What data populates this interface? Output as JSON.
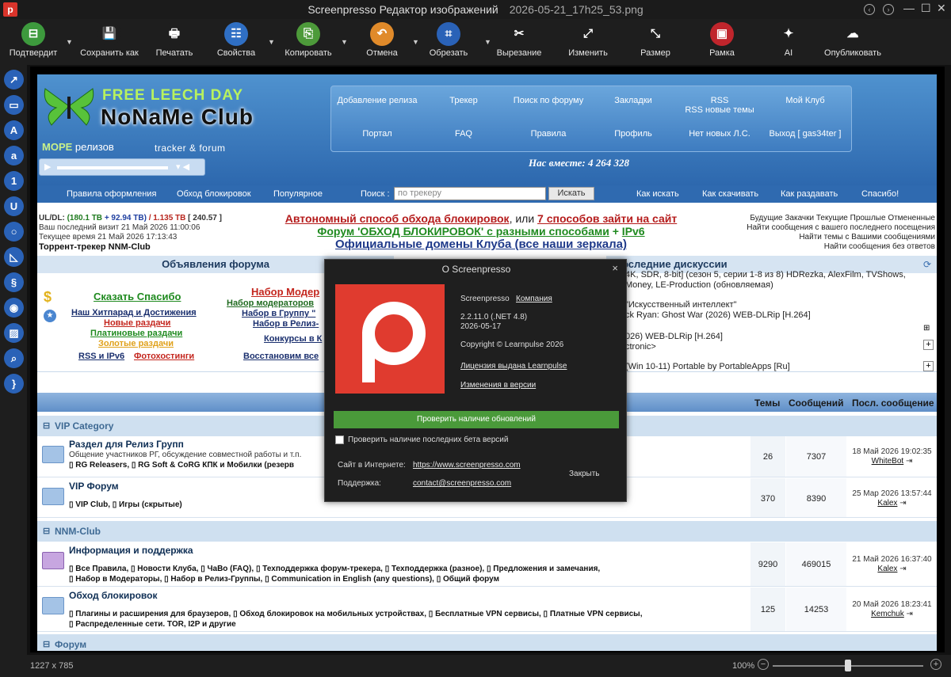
{
  "titlebar": {
    "app": "Screenpresso Редактор изображений",
    "file": "2026-05-21_17h25_53.png",
    "logo_icon": "screenpresso-logo-icon"
  },
  "toolbar": [
    {
      "label": "Подтвердит",
      "icon": "confirm-icon",
      "glyph": "⊟",
      "color": "#3d9a3d"
    },
    {
      "label": "Сохранить как",
      "icon": "save-icon",
      "glyph": "💾",
      "color": "#1e1e1e"
    },
    {
      "label": "Печатать",
      "icon": "print-icon",
      "glyph": "🖶",
      "color": "#1e1e1e"
    },
    {
      "label": "Свойства",
      "icon": "properties-icon",
      "glyph": "☷",
      "color": "#2f6fc4"
    },
    {
      "label": "Копировать",
      "icon": "copy-icon",
      "glyph": "⎘",
      "color": "#4d9a3a"
    },
    {
      "label": "Отмена",
      "icon": "undo-icon",
      "glyph": "↶",
      "color": "#e08a2a"
    },
    {
      "label": "Обрезать",
      "icon": "crop-icon",
      "glyph": "⌗",
      "color": "#2a62b7"
    },
    {
      "label": "Вырезание",
      "icon": "cut-icon",
      "glyph": "✂",
      "color": "#1e1e1e"
    },
    {
      "label": "Изменить",
      "icon": "edit-icon",
      "glyph": "⤢",
      "color": "#1e1e1e"
    },
    {
      "label": "Размер",
      "icon": "resize-icon",
      "glyph": "⤡",
      "color": "#1e1e1e"
    },
    {
      "label": "Рамка",
      "icon": "frame-icon",
      "glyph": "▣",
      "color": "#c0252c"
    },
    {
      "label": "AI",
      "icon": "ai-sparkle-icon",
      "glyph": "✦",
      "color": "#1e1e1e"
    },
    {
      "label": "Опубликовать",
      "icon": "cloud-upload-icon",
      "glyph": "☁",
      "color": "#1e1e1e"
    }
  ],
  "left_tools": [
    {
      "icon": "arrow-tool-icon",
      "glyph": "↗"
    },
    {
      "icon": "rectangle-tool-icon",
      "glyph": "▭"
    },
    {
      "icon": "text-tool-icon",
      "glyph": "A"
    },
    {
      "icon": "callout-tool-icon",
      "glyph": "a"
    },
    {
      "icon": "step-number-tool-icon",
      "glyph": "1"
    },
    {
      "icon": "magnet-tool-icon",
      "glyph": "U"
    },
    {
      "icon": "ellipse-tool-icon",
      "glyph": "○"
    },
    {
      "icon": "highlight-tool-icon",
      "glyph": "◺"
    },
    {
      "icon": "freehand-tool-icon",
      "glyph": "§"
    },
    {
      "icon": "blur-tool-icon",
      "glyph": "◉"
    },
    {
      "icon": "image-tool-icon",
      "glyph": "▨"
    },
    {
      "icon": "magnifier-tool-icon",
      "glyph": "⌕"
    },
    {
      "icon": "bracket-tool-icon",
      "glyph": "}"
    }
  ],
  "status": {
    "size": "1227 x 785",
    "zoom": "100%",
    "zoom_minus": "−",
    "zoom_plus": "+",
    "zoom_fraction": 0.5
  },
  "web": {
    "free_leech": "FREE LEECH DAY",
    "brand": "NoNaMe Club",
    "more_bold": "МОРЕ",
    "more_rest": "релизов",
    "tracker": "tracker & forum",
    "together": "Нас вместе: 4 264 328",
    "nav_row1": [
      "Добавление релиза",
      "Трекер",
      "Поиск по форуму",
      "Закладки",
      "RSS\nRSS новые темы",
      "Мой Клуб"
    ],
    "nav_row2": [
      "Портал",
      "FAQ",
      "Правила",
      "Профиль",
      "Нет новых Л.С.",
      "Выход [ gas34ter ]"
    ],
    "subnav": {
      "rules": "Правила оформления",
      "bypass": "Обход блокировок",
      "popular": "Популярное",
      "search_label": "Поиск :",
      "search_placeholder": "по трекеру",
      "search_btn": "Искать",
      "how_search": "Как искать",
      "how_dl": "Как скачивать",
      "how_seed": "Как раздавать",
      "thanks": "Спасибо!"
    },
    "ul_dl_label": "UL/DL:",
    "ul": "(180.1 TB",
    "dl": "+ 92.94 TB)",
    "ratio": "/ 1.135 TB",
    "ratio2": "[ 240.57 ]",
    "last_visit": "Ваш последний визит 21 Май 2026 11:00:06",
    "now_time": "Текущее время 21 Май 2026 17:13:43",
    "site_name": "Торрент-трекер NNM-Club",
    "promo1a": "Автономный способ обхода блокировок",
    "promo1b": ", или ",
    "promo1c": "7 способов зайти на сайт",
    "promo2a": "Форум 'ОБХОД БЛОКИРОВОК' с разными способами",
    "promo2b": " + ",
    "promo2c": "IPv6",
    "promo3": "Официальные домены Клуба (все наши зеркала)",
    "right_links": [
      "Будущие Закачки Текущие Прошлые Отмененные",
      "Найти сообщения с вашего последнего посещения",
      "Найти темы с Вашими сообщениями",
      "Найти сообщения без ответов"
    ],
    "ann_head": "Объявления форума",
    "disc_head": "оследние дискуссии",
    "ann": {
      "say_thanks": "Сказать Спасибо",
      "hitparade": "Наш Хитпарад и Достижения",
      "new": "Новые раздачи",
      "platinum": "Платиновые раздачи",
      "gold": "Золотые раздачи",
      "rss": "RSS и IPv6",
      "photo": "Фотохостинги",
      "mod_recruit": "Набор Модер",
      "mod_recruit2": "Набор модераторов",
      "group1": "Набор в Группу \"",
      "group2": "Набор в Релиз-",
      "contests": "Конкурсы в К",
      "restore": "Восстановим все"
    },
    "disc": [
      "4K, SDR, 8-bit] (сезон 5, серии 1-8 из 8) HDRezka, AlexFilm, TVShows,",
      "Money, LE-Production (обновляемая)",
      "\"Искусственный интеллект\"",
      "ck Ryan: Ghost War (2026) WEB-DLRip [H.264]",
      "026) WEB-DLRip [H.264]",
      "ctronic>",
      "(Win 10-11) Portable by PortableApps [Ru]"
    ],
    "table": {
      "topics": "Темы",
      "posts": "Сообщений",
      "last": "Посл. сообщение"
    },
    "cats": [
      "VIP Category",
      "NNM-Club",
      "Форум"
    ],
    "rows": [
      {
        "title": "Раздел для Релиз Групп",
        "desc": "Общение участников РГ, обсуждение совместной работы и т.п.",
        "subs": "▯ RG Releasers, ▯ RG Soft & CoRG КПК и Мобилки (резерв",
        "topics": "26",
        "posts": "7307",
        "date": "18 Май 2026 19:02:35",
        "user": "WhiteBot"
      },
      {
        "title": "VIP Форум",
        "desc": "",
        "subs": "▯ VIP Club, ▯ Игры (скрытые)",
        "topics": "370",
        "posts": "8390",
        "date": "25 Мар 2026 13:57:44",
        "user": "Kalex"
      },
      {
        "title": "Информация и поддержка",
        "desc": "",
        "subs": "▯ Все Правила, ▯ Новости Клуба, ▯ ЧаВо (FAQ), ▯ Техподдержка форум-трекера, ▯ Техподдержка (разное), ▯ Предложения и замечания,",
        "subs2": "▯ Набор в Модераторы, ▯ Набор в Релиз-Группы, ▯ Communication in English (any questions), ▯ Общий форум",
        "topics": "9290",
        "posts": "469015",
        "date": "21 Май 2026 16:37:40",
        "user": "Kalex"
      },
      {
        "title": "Обход блокировок",
        "desc": "",
        "subs": "▯ Плагины и расширения для браузеров, ▯ Обход блокировок на мобильных устройствах, ▯ Бесплатные VPN сервисы, ▯ Платные VPN сервисы,",
        "subs2": "▯ Распределенные сети. TOR, I2P и другие",
        "topics": "125",
        "posts": "14253",
        "date": "20 Май 2026 18:23:41",
        "user": "Kemchuk"
      }
    ]
  },
  "dialog": {
    "title": "О Screenpresso",
    "close_x": "×",
    "product": "Screenpresso",
    "company": "Компания",
    "version": "2.2.11.0 (.NET 4.8)",
    "date": "2026-05-17",
    "copyright": "Copyright © Learnpulse 2026",
    "license": "Лицензия выдана Learnpulse",
    "changes": "Изменения в версии",
    "check_updates": "Проверить наличие обновлений",
    "beta_label": "Проверить наличие последних бета версий",
    "beta_checked": false,
    "site_label": "Сайт в Интернете:",
    "site": "https://www.screenpresso.com",
    "support_label": "Поддержка:",
    "support": "contact@screenpresso.com",
    "close_btn": "Закрыть"
  }
}
